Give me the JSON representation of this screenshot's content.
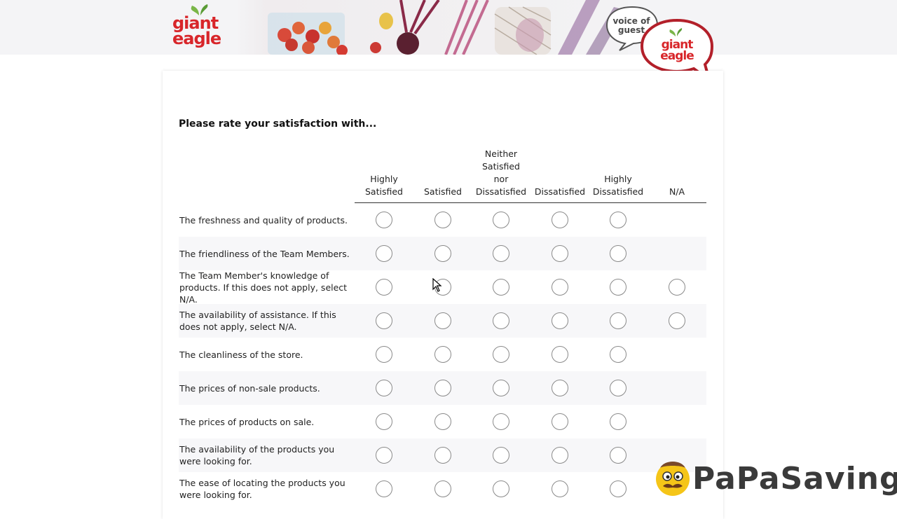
{
  "header": {
    "logo_line1": "giant",
    "logo_line2": "eagle",
    "voice_line1": "voice of",
    "voice_line2": "guest",
    "bubble_line1": "giant",
    "bubble_line2": "eagle",
    "brand_color": "#d8262a"
  },
  "survey": {
    "question": "Please rate your satisfaction with...",
    "columns": [
      "Highly\nSatisfied",
      "Satisfied",
      "Neither\nSatisfied\nnor\nDissatisfied",
      "Dissatisfied",
      "Highly\nDissatisfied",
      "N/A"
    ],
    "rows": [
      {
        "label": "The freshness and quality of products.",
        "has_na": false
      },
      {
        "label": "The friendliness of the Team Members.",
        "has_na": false
      },
      {
        "label": "The Team Member's knowledge of products. If this does not apply, select N/A.",
        "has_na": true
      },
      {
        "label": "The availability of assistance. If this does not apply, select N/A.",
        "has_na": true
      },
      {
        "label": "The cleanliness of the store.",
        "has_na": false
      },
      {
        "label": "The prices of non-sale products.",
        "has_na": false
      },
      {
        "label": "The prices of products on sale.",
        "has_na": false
      },
      {
        "label": "The availability of the products you were looking for.",
        "has_na": false
      },
      {
        "label": "The ease of locating the products you were looking for.",
        "has_na": false
      }
    ]
  },
  "watermark": {
    "text": "PaPaSavings",
    "icon": "mascot-face-icon"
  }
}
